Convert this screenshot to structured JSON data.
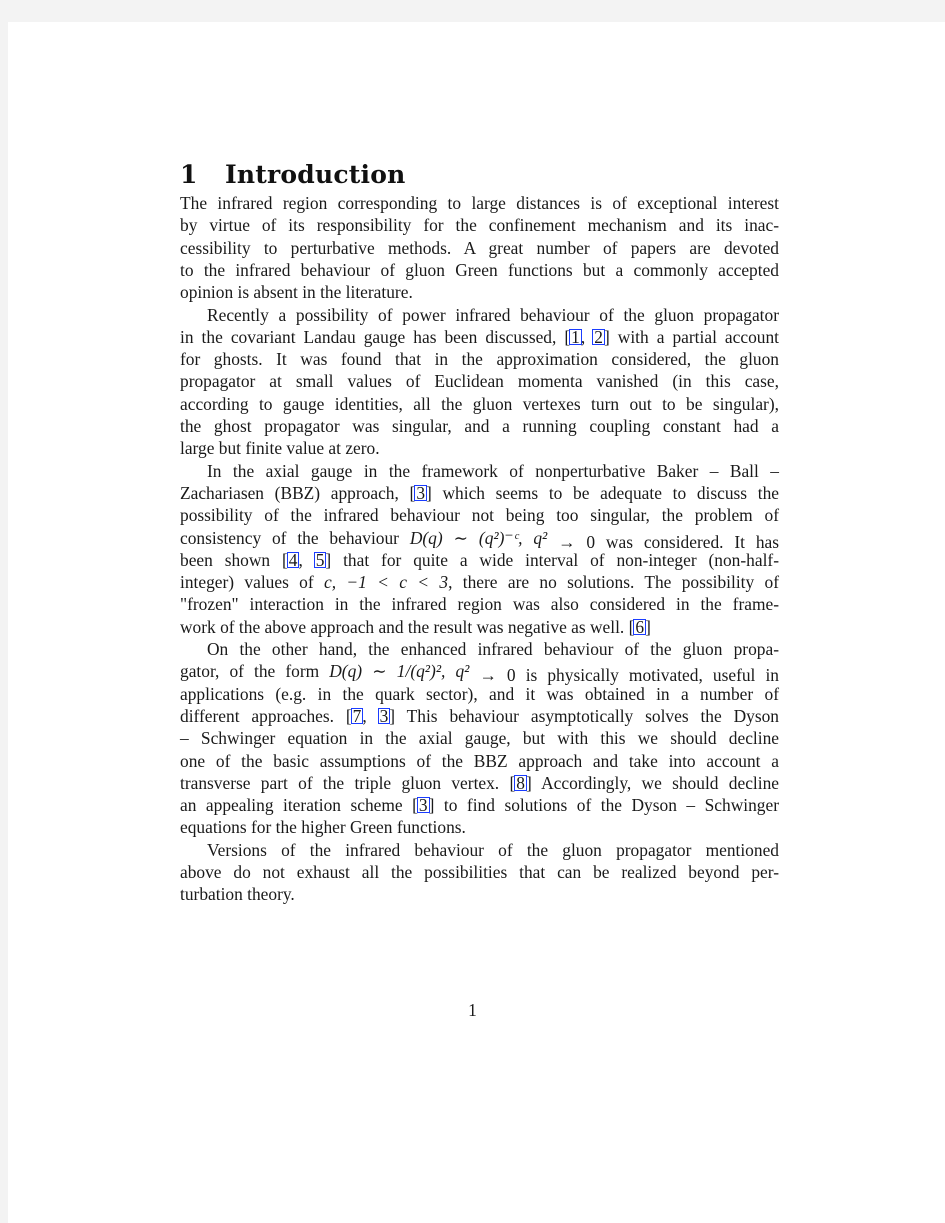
{
  "section": {
    "number": "1",
    "title": "Introduction"
  },
  "paragraphs": [
    {
      "lines": [
        "The infrared region corresponding to large distances is of exceptional interest",
        "by virtue of its responsibility for the confinement mechanism and its inac-",
        "cessibility to perturbative methods. A great number of papers are devoted",
        "to the infrared behaviour of gluon Green functions but a commonly accepted",
        "opinion is absent in the literature."
      ]
    },
    {
      "lines": [
        "Recently a possibility of power infrared behaviour of the gluon propagator",
        {
          "pre": "in the covariant Landau gauge has been discussed, [",
          "cites": [
            "1",
            "2"
          ],
          "post": "] with a partial account"
        },
        "for ghosts. It was found that in the approximation considered, the gluon",
        "propagator at small values of Euclidean momenta vanished (in this case,",
        "according to gauge identities, all the gluon vertexes turn out to be singular),",
        "the ghost propagator was singular, and a running coupling constant had a",
        "large but finite value at zero."
      ]
    },
    {
      "lines": [
        "In the axial gauge in the framework of nonperturbative Baker – Ball –",
        {
          "pre": "Zachariasen (BBZ) approach, [",
          "cites": [
            "3"
          ],
          "post": "] which seems to be adequate to discuss the"
        },
        "possibility of the infrared behaviour not being too singular, the problem of",
        {
          "pre": "consistency of the behaviour ",
          "math": "D(q) ∼ (q²)⁻ᶜ, q²",
          "post": " → 0 was considered. It has"
        },
        {
          "pre": "been shown [",
          "cites": [
            "4",
            "5"
          ],
          "post": "] that for quite a wide interval of non-integer (non-half-"
        },
        {
          "pre": "integer) values of ",
          "math": "c, −1 < c < 3",
          "post": ", there are no solutions. The possibility of"
        },
        "\"frozen\" interaction in the infrared region was also considered in the frame-",
        {
          "pre": "work of the above approach and the result was negative as well. [",
          "cites": [
            "6"
          ],
          "post": "]"
        }
      ]
    },
    {
      "lines": [
        "On the other hand, the enhanced infrared behaviour of the gluon propa-",
        {
          "pre": "gator, of the form ",
          "math": "D(q) ∼ 1/(q²)², q²",
          "post": " → 0 is physically motivated, useful in"
        },
        "applications (e.g. in the quark sector), and it was obtained in a number of",
        {
          "pre": "different approaches. [",
          "cites": [
            "7",
            "3"
          ],
          "post": "] This behaviour asymptotically solves the Dyson"
        },
        "– Schwinger equation in the axial gauge, but with this we should decline",
        "one of the basic assumptions of the BBZ approach and take into account a",
        {
          "pre": "transverse part of the triple gluon vertex. [",
          "cites": [
            "8"
          ],
          "post": "] Accordingly, we should decline"
        },
        {
          "pre": "an appealing iteration scheme [",
          "cites": [
            "3"
          ],
          "post": "] to find solutions of the Dyson – Schwinger"
        },
        "equations for the higher Green functions."
      ]
    },
    {
      "lines": [
        "Versions of the infrared behaviour of the gluon propagator mentioned",
        "above do not exhaust all the possibilities that can be realized beyond per-",
        "turbation theory."
      ]
    }
  ],
  "page_number": "1",
  "colors": {
    "background": "#f3f3f3",
    "page": "#ffffff",
    "text": "#1a1a1a",
    "link_box": "#1a3cff"
  }
}
